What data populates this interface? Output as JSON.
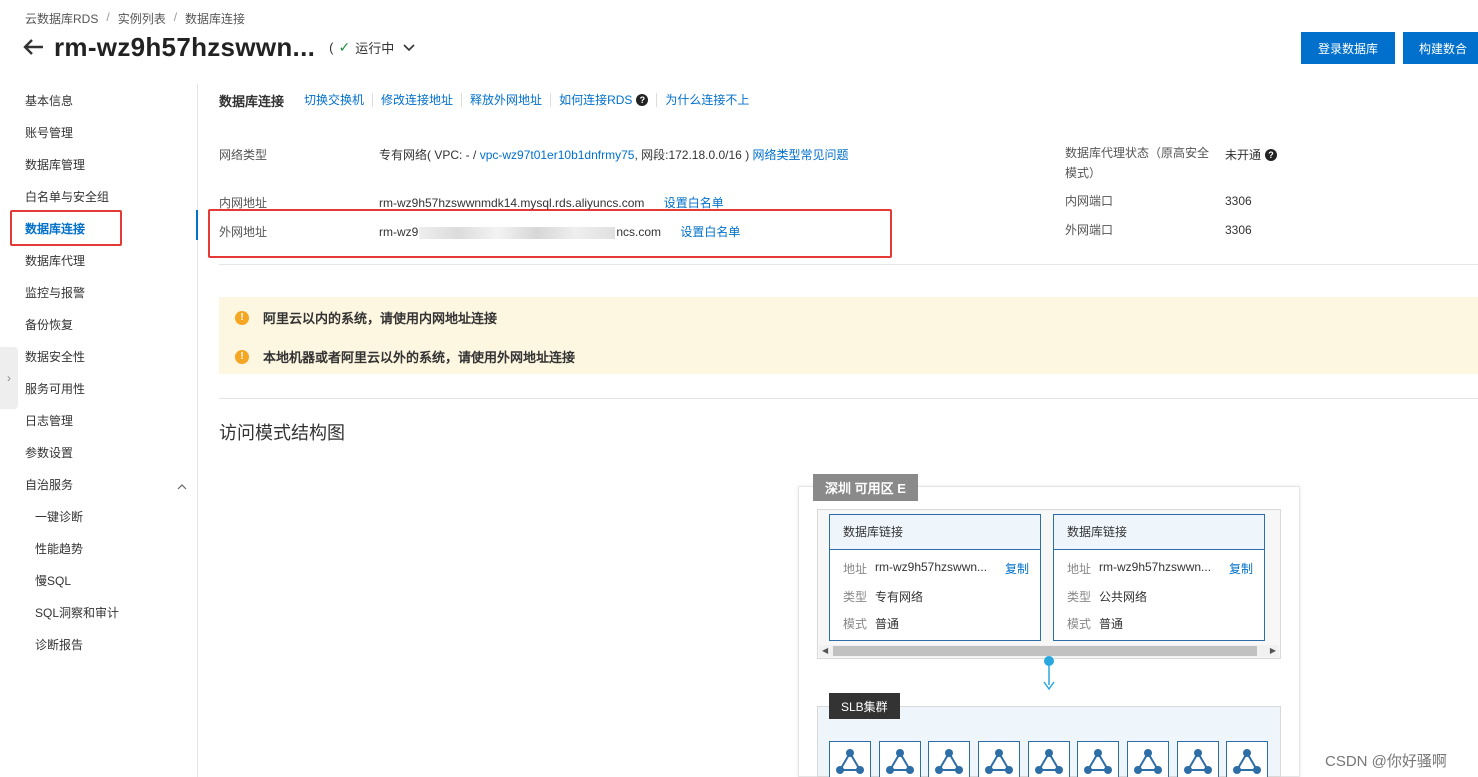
{
  "breadcrumb": [
    "云数据库RDS",
    "实例列表",
    "数据库连接"
  ],
  "header": {
    "title": "rm-wz9h57hzswwn...",
    "status_open": "(",
    "status": "运行中",
    "login_button": "登录数据库",
    "build_button": "构建数合"
  },
  "sidebar": {
    "items": [
      "基本信息",
      "账号管理",
      "数据库管理",
      "白名单与安全组",
      "数据库连接",
      "数据库代理",
      "监控与报警",
      "备份恢复",
      "数据安全性",
      "服务可用性",
      "日志管理",
      "参数设置",
      "自治服务"
    ],
    "sub_items": [
      "一键诊断",
      "性能趋势",
      "慢SQL",
      "SQL洞察和审计",
      "诊断报告"
    ],
    "active": "数据库连接"
  },
  "toolbar": {
    "heading": "数据库连接",
    "links": [
      "切换交换机",
      "修改连接地址",
      "释放外网地址",
      "如何连接RDS",
      "为什么连接不上"
    ]
  },
  "info": {
    "network_label": "网络类型",
    "network_prefix": "专有网络( VPC: - /",
    "vpc_id": "vpc-wz97t01er10b1dnfrmy75",
    "network_suffix": ", 网段:172.18.0.0/16 )",
    "network_faq": "网络类型常见问题",
    "intranet_label": "内网地址",
    "intranet_value": "rm-wz9h57hzswwnmdk14.mysql.rds.aliyuncs.com",
    "intranet_whitelist": "设置白名单",
    "internet_label": "外网地址",
    "internet_prefix": "rm-wz9",
    "internet_suffix": "ncs.com",
    "internet_whitelist": "设置白名单",
    "proxy_label": "数据库代理状态（原高安全模式）",
    "proxy_value": "未开通",
    "intranet_port_label": "内网端口",
    "intranet_port": "3306",
    "internet_port_label": "外网端口",
    "internet_port": "3306"
  },
  "notice": {
    "line1": "阿里云以内的系统，请使用内网地址连接",
    "line2": "本地机器或者阿里云以外的系统，请使用外网地址连接"
  },
  "diagram": {
    "section_title": "访问模式结构图",
    "zone": "深圳 可用区 E",
    "cards": [
      {
        "title": "数据库链接",
        "addr_key": "地址",
        "addr": "rm-wz9h57hzswwn...",
        "copy": "复制",
        "type_key": "类型",
        "type": "专有网络",
        "mode_key": "模式",
        "mode": "普通"
      },
      {
        "title": "数据库链接",
        "addr_key": "地址",
        "addr": "rm-wz9h57hzswwn...",
        "copy": "复制",
        "type_key": "类型",
        "type": "公共网络",
        "mode_key": "模式",
        "mode": "普通"
      }
    ],
    "slb": "SLB集群"
  },
  "watermark": "CSDN @你好骚啊",
  "colors": {
    "accent": "#0070cc",
    "highlight": "#e53935",
    "notice_bg": "#fdf6e0",
    "warn": "#f5a623",
    "success": "#1e8e3e"
  }
}
